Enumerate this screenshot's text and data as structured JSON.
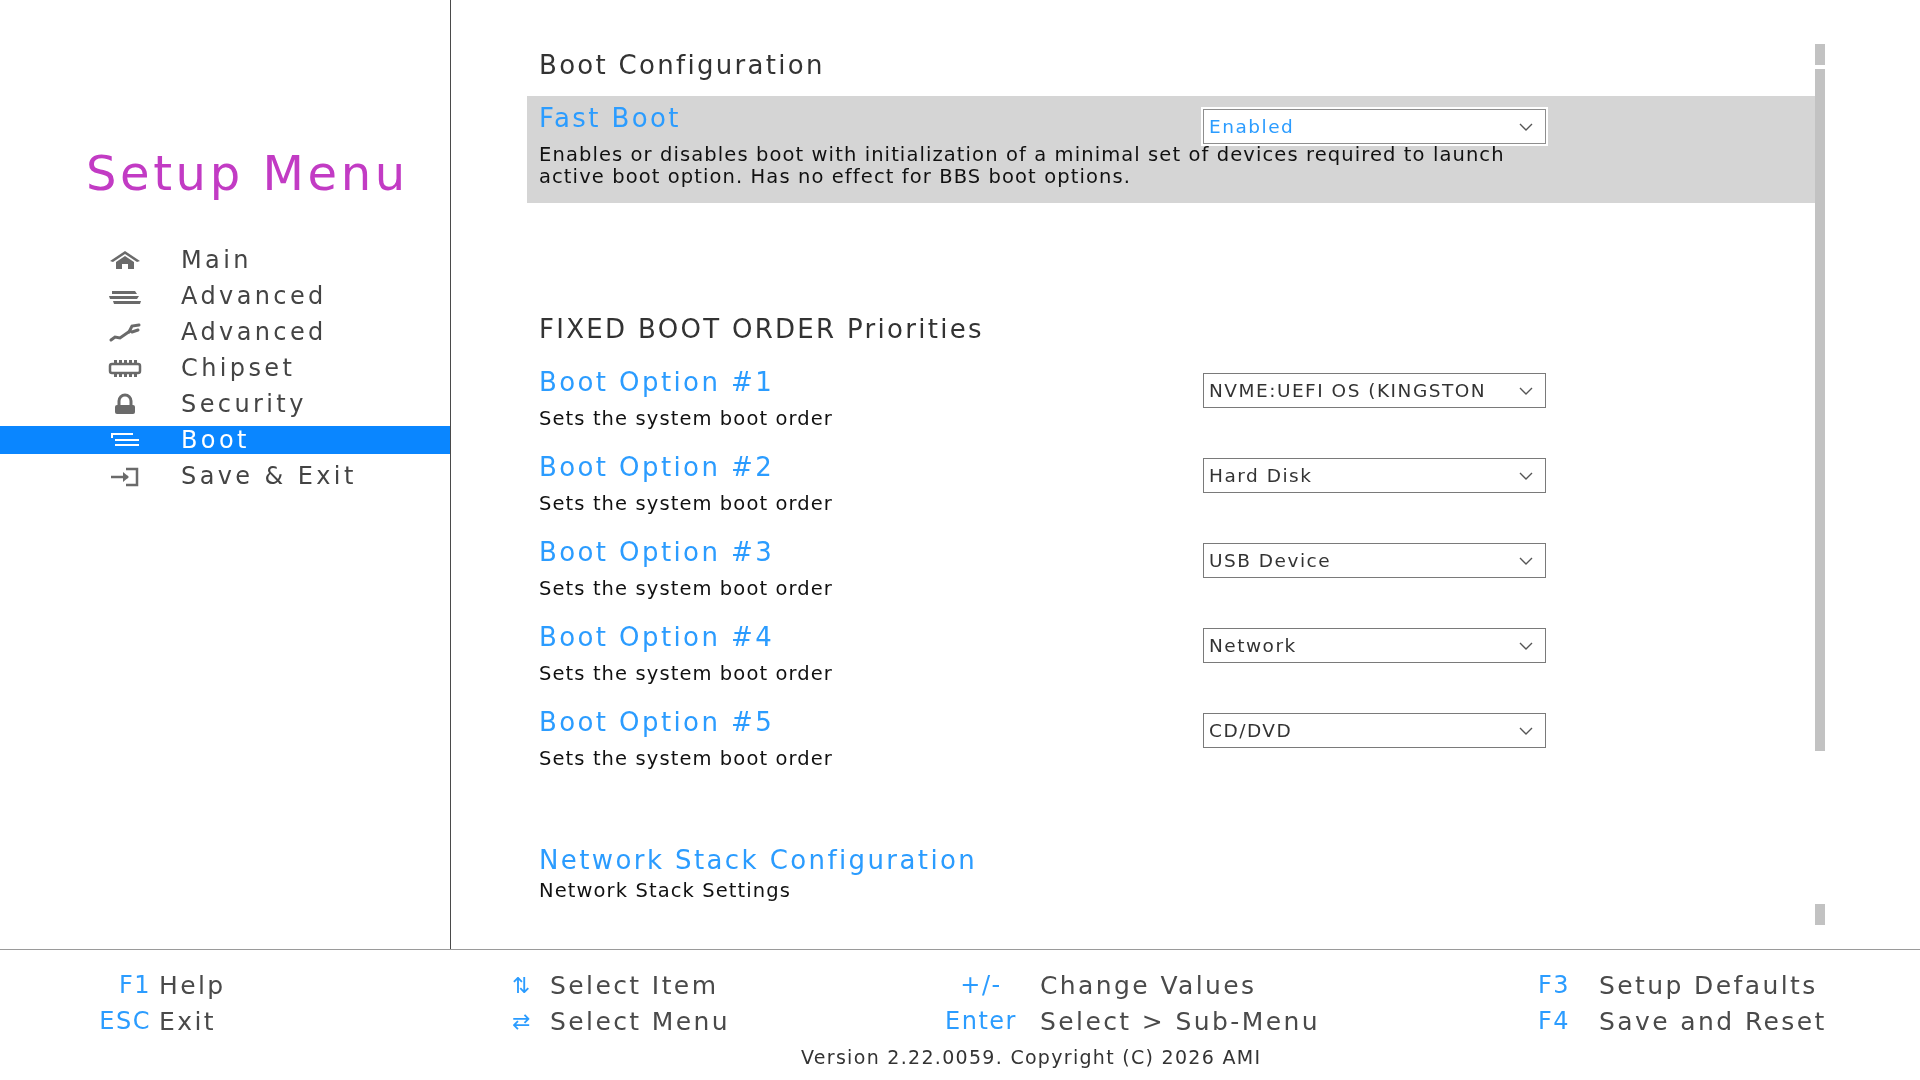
{
  "sidebar": {
    "title": "Setup Menu",
    "items": [
      {
        "label": "Main",
        "selected": false
      },
      {
        "label": "Advanced",
        "selected": false
      },
      {
        "label": "Advanced",
        "selected": false
      },
      {
        "label": "Chipset",
        "selected": false
      },
      {
        "label": "Security",
        "selected": false
      },
      {
        "label": "Boot",
        "selected": true
      },
      {
        "label": "Save & Exit",
        "selected": false
      }
    ]
  },
  "content": {
    "sections": [
      {
        "heading": "Boot Configuration",
        "items": [
          {
            "kind": "dropdown",
            "label": "Fast Boot",
            "value": "Enabled",
            "help": "Enables or disables boot with initialization of a minimal set of devices required to launch active boot option. Has no effect for BBS boot options.",
            "selected": true
          }
        ]
      },
      {
        "heading": "FIXED BOOT ORDER Priorities",
        "items": [
          {
            "kind": "dropdown",
            "label": "Boot Option #1",
            "value": "NVME:UEFI OS (KINGSTON",
            "help": "Sets the system boot order",
            "selected": false
          },
          {
            "kind": "dropdown",
            "label": "Boot Option #2",
            "value": "Hard Disk",
            "help": "Sets the system boot order",
            "selected": false
          },
          {
            "kind": "dropdown",
            "label": "Boot Option #3",
            "value": "USB Device",
            "help": "Sets the system boot order",
            "selected": false
          },
          {
            "kind": "dropdown",
            "label": "Boot Option #4",
            "value": "Network",
            "help": "Sets the system boot order",
            "selected": false
          },
          {
            "kind": "dropdown",
            "label": "Boot Option #5",
            "value": "CD/DVD",
            "help": "Sets the system boot order",
            "selected": false
          }
        ]
      },
      {
        "items": [
          {
            "kind": "submenu",
            "label": "Network Stack Configuration",
            "help": "Network Stack Settings",
            "selected": false
          }
        ]
      }
    ]
  },
  "footer": {
    "columns": [
      {
        "hints": [
          {
            "key": "F1",
            "action": "Help"
          },
          {
            "key": "ESC",
            "action": "Exit"
          }
        ]
      },
      {
        "hints": [
          {
            "key": "⇅",
            "action": "Select Item"
          },
          {
            "key": "⇄",
            "action": "Select Menu"
          }
        ]
      },
      {
        "hints": [
          {
            "key": "+/-",
            "action": "Change Values"
          },
          {
            "key": "Enter",
            "action": "Select > Sub-Menu"
          }
        ]
      },
      {
        "hints": [
          {
            "key": "F3",
            "action": "Setup Defaults"
          },
          {
            "key": "F4",
            "action": "Save and Reset"
          }
        ]
      }
    ],
    "version": "Version 2.22.0059. Copyright (C) 2026 AMI"
  }
}
